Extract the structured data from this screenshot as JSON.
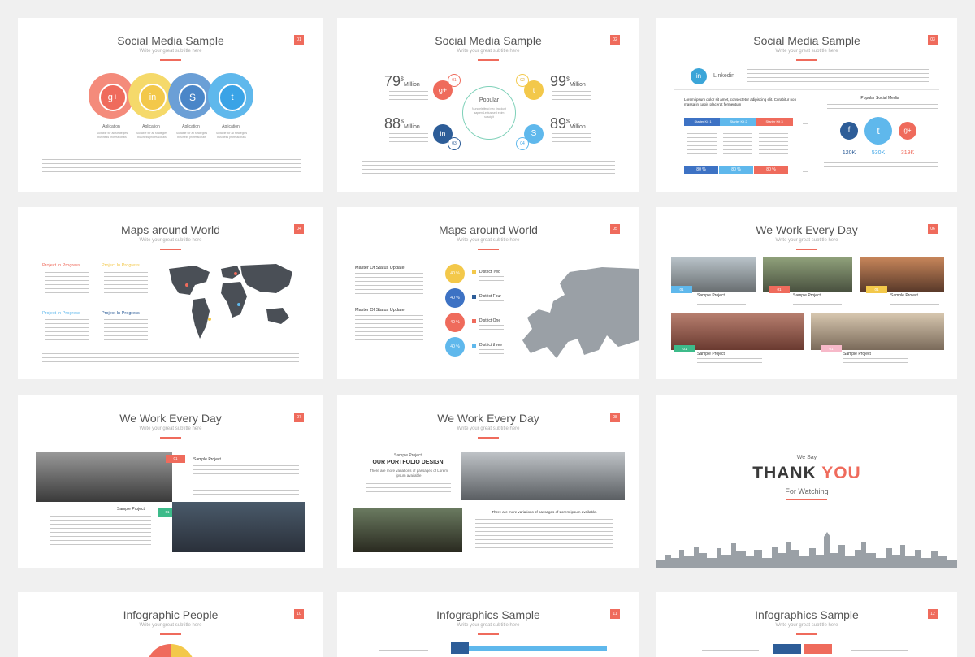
{
  "slides": [
    {
      "title": "Social Media Sample",
      "subtitle": "Write your great subtitle here",
      "num": "01"
    },
    {
      "title": "Social Media Sample",
      "subtitle": "Write your great subtitle here",
      "num": "02"
    },
    {
      "title": "Social Media Sample",
      "subtitle": "Write your great subtitle here",
      "num": "03"
    },
    {
      "title": "Maps around World",
      "subtitle": "Write your great subtitle here",
      "num": "04"
    },
    {
      "title": "Maps around World",
      "subtitle": "Write your great subtitle here",
      "num": "05"
    },
    {
      "title": "We Work Every Day",
      "subtitle": "Write your great subtitle here",
      "num": "06"
    },
    {
      "title": "We Work Every Day",
      "subtitle": "Write your great subtitle here",
      "num": "07"
    },
    {
      "title": "We Work Every Day",
      "subtitle": "Write your great subtitle here",
      "num": "08"
    },
    {
      "title": "Infographic People",
      "subtitle": "Write your great subtitle here",
      "num": "10"
    },
    {
      "title": "Infographics Sample",
      "subtitle": "Write your great subtitle here",
      "num": "11"
    },
    {
      "title": "Infographics Sample",
      "subtitle": "Write your great subtitle here",
      "num": "12"
    }
  ],
  "s1": {
    "label": "Aplication",
    "desc": "Suitable for all strategies business professionals"
  },
  "s2": {
    "stats": [
      {
        "num": "79",
        "unit": "Million",
        "sup": "$",
        "badge": "01"
      },
      {
        "num": "88",
        "unit": "Million",
        "sup": "$",
        "badge": "03"
      },
      {
        "num": "99",
        "unit": "Million",
        "sup": "$",
        "badge": "02"
      },
      {
        "num": "89",
        "unit": "Million",
        "sup": "$",
        "badge": "04"
      }
    ],
    "center_title": "Popular",
    "center_text": "Nunc eleifend nec tincidunt sapien Lectus sed enim suscipit"
  },
  "s3": {
    "linkedin": "Linkedin",
    "lead": "Lorem ipsum dolor sit amet, consectetur adipiscing elit. Curabitur non massa in turpis placerat fermentum",
    "tabs": [
      "Starter Kit 1",
      "Starter Kit 2",
      "Starter Kit 3"
    ],
    "pcts": [
      "80 %",
      "80 %",
      "80 %"
    ],
    "popular": "Popular Social Media",
    "counts": [
      "120K",
      "530K",
      "319K"
    ]
  },
  "s4": {
    "projects": [
      "Project In Progress",
      "Project In Progress",
      "Project In Progress",
      "Project In Progress"
    ]
  },
  "s5": {
    "heads": [
      "Master Of Status Update",
      "Master Of Status Update"
    ],
    "pcts": [
      "40 %",
      "40 %",
      "40 %",
      "40 %"
    ],
    "districts": [
      "District Two",
      "District Four",
      "District One",
      "District three"
    ]
  },
  "s6": {
    "label": "Sample Project",
    "tags": [
      "01",
      "01",
      "01",
      "01",
      "01"
    ]
  },
  "s7": {
    "label": "Sample Project",
    "tags": [
      "01",
      "01"
    ]
  },
  "s8": {
    "sample": "Sample Project",
    "portfolio": "OUR PORTFOLIO DESIGN",
    "caption": "There are more variations of passages of Lorem ipsum available",
    "quote": "There are more variations of passages of Lorem ipsum available."
  },
  "s9": {
    "we_say": "We Say",
    "thank": "THANK",
    "you": "YOU",
    "for": "For Watching"
  }
}
